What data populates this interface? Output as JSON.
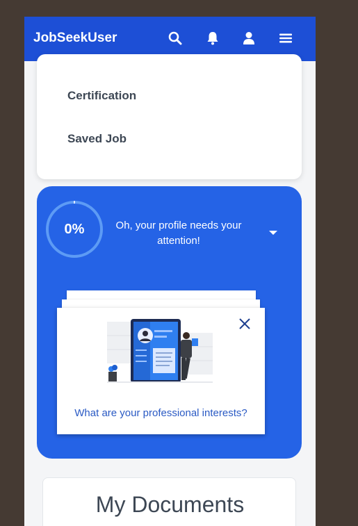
{
  "navbar": {
    "brand": "JobSeekUser",
    "icons": [
      "search-icon",
      "bell-icon",
      "user-icon",
      "menu-icon"
    ],
    "color": "#1d4fd6"
  },
  "menu": {
    "items": [
      {
        "label": "Certification"
      },
      {
        "label": "Saved Job"
      }
    ]
  },
  "profile": {
    "completion_label": "0%",
    "completion_value": 0,
    "message": "Oh, your profile needs your attention!",
    "color": "#2563e6"
  },
  "interest_card": {
    "question": "What are your professional interests?",
    "illustration": "resume-illustration"
  },
  "documents": {
    "title": "My Documents"
  },
  "colors": {
    "background": "#453a33",
    "link": "#2a5ac4",
    "text": "#3d4754"
  }
}
